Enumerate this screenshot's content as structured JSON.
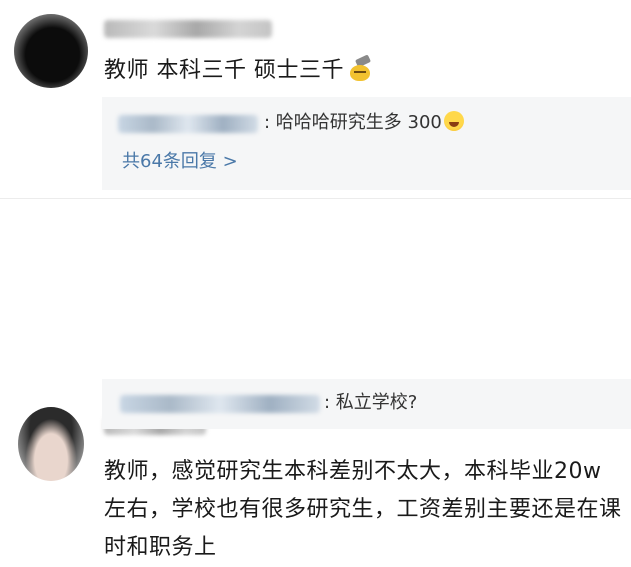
{
  "comments": [
    {
      "text": "教师 本科三千 硕士三千",
      "reply": {
        "text": ": 哈哈哈研究生多 300",
        "more_label": "共64条回复 >"
      }
    },
    {
      "text": "教师，感觉研究生本科差别不太大，本科毕业20w左右，学校也有很多研究生，工资差别主要还是在课时和职务上",
      "reply": {
        "text": ": 私立学校?"
      }
    }
  ],
  "icons": {
    "comment1_emoji": "hammer-emoji-icon",
    "reply1_emoji": "laughing-tears-icon"
  },
  "colors": {
    "link": "#4a78a8",
    "reply_bg": "#f5f6f7"
  }
}
